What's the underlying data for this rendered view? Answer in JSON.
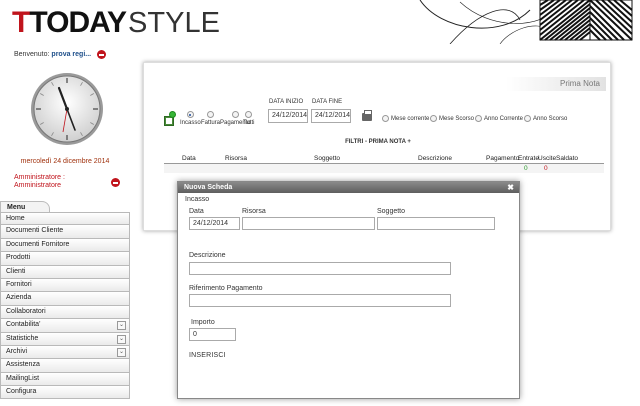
{
  "header": {
    "logo_part1": "TODAY",
    "logo_part2": "STYLE"
  },
  "welcome": {
    "label": "Benvenuto:",
    "user": "prova regi..."
  },
  "date": "mercoledì 24 dicembre 2014",
  "role": {
    "line1": "Amministratore :",
    "line2": "Amministratore"
  },
  "menu": {
    "tab_label": "Menu",
    "items": [
      {
        "label": "Home",
        "expandable": false
      },
      {
        "label": "Documenti Cliente",
        "expandable": false
      },
      {
        "label": "Documenti Fornitore",
        "expandable": false
      },
      {
        "label": "Prodotti",
        "expandable": false
      },
      {
        "label": "Clienti",
        "expandable": false
      },
      {
        "label": "Fornitori",
        "expandable": false
      },
      {
        "label": "Azienda",
        "expandable": false
      },
      {
        "label": "Collaboratori",
        "expandable": false
      },
      {
        "label": "Contabilita'",
        "expandable": true
      },
      {
        "label": "Statistiche",
        "expandable": true
      },
      {
        "label": "Archivi",
        "expandable": true
      },
      {
        "label": "Assistenza",
        "expandable": false
      },
      {
        "label": "MailingList",
        "expandable": false
      },
      {
        "label": "Configura",
        "expandable": false
      }
    ]
  },
  "panel": {
    "title": "Prima Nota",
    "type_options": [
      "Incasso",
      "Fattura",
      "Pagamento",
      "Tutti"
    ],
    "date_start_label": "DATA INIZIO",
    "date_start_value": "24/12/2014",
    "date_end_label": "DATA FINE",
    "date_end_value": "24/12/2014",
    "period_options": [
      "Mese corrente",
      "Mese Scorso",
      "Anno Corrente",
      "Anno Scorso"
    ],
    "filters_label": "FILTRI - PRIMA NOTA +",
    "columns": [
      "Data",
      "Risorsa",
      "Soggetto",
      "Descrizione",
      "Pagamento",
      "Entrate",
      "Uscite",
      "Saldato"
    ],
    "totals": {
      "entrate": "0",
      "uscite": "0"
    }
  },
  "modal": {
    "title": "Nuova Scheda",
    "close": "✖",
    "type": "Incasso",
    "data_label": "Data",
    "data_value": "24/12/2014",
    "risorsa_label": "Risorsa",
    "soggetto_label": "Soggetto",
    "descrizione_label": "Descrizione",
    "riferimento_label": "Riferimento Pagamento",
    "importo_label": "Importo",
    "importo_value": "0",
    "submit_label": "INSERISCI"
  },
  "colors": {
    "brand_red": "#c0141c",
    "link_blue": "#1e4f8a",
    "entrate_green": "#2a9a2a",
    "uscite_red": "#c0141c"
  }
}
